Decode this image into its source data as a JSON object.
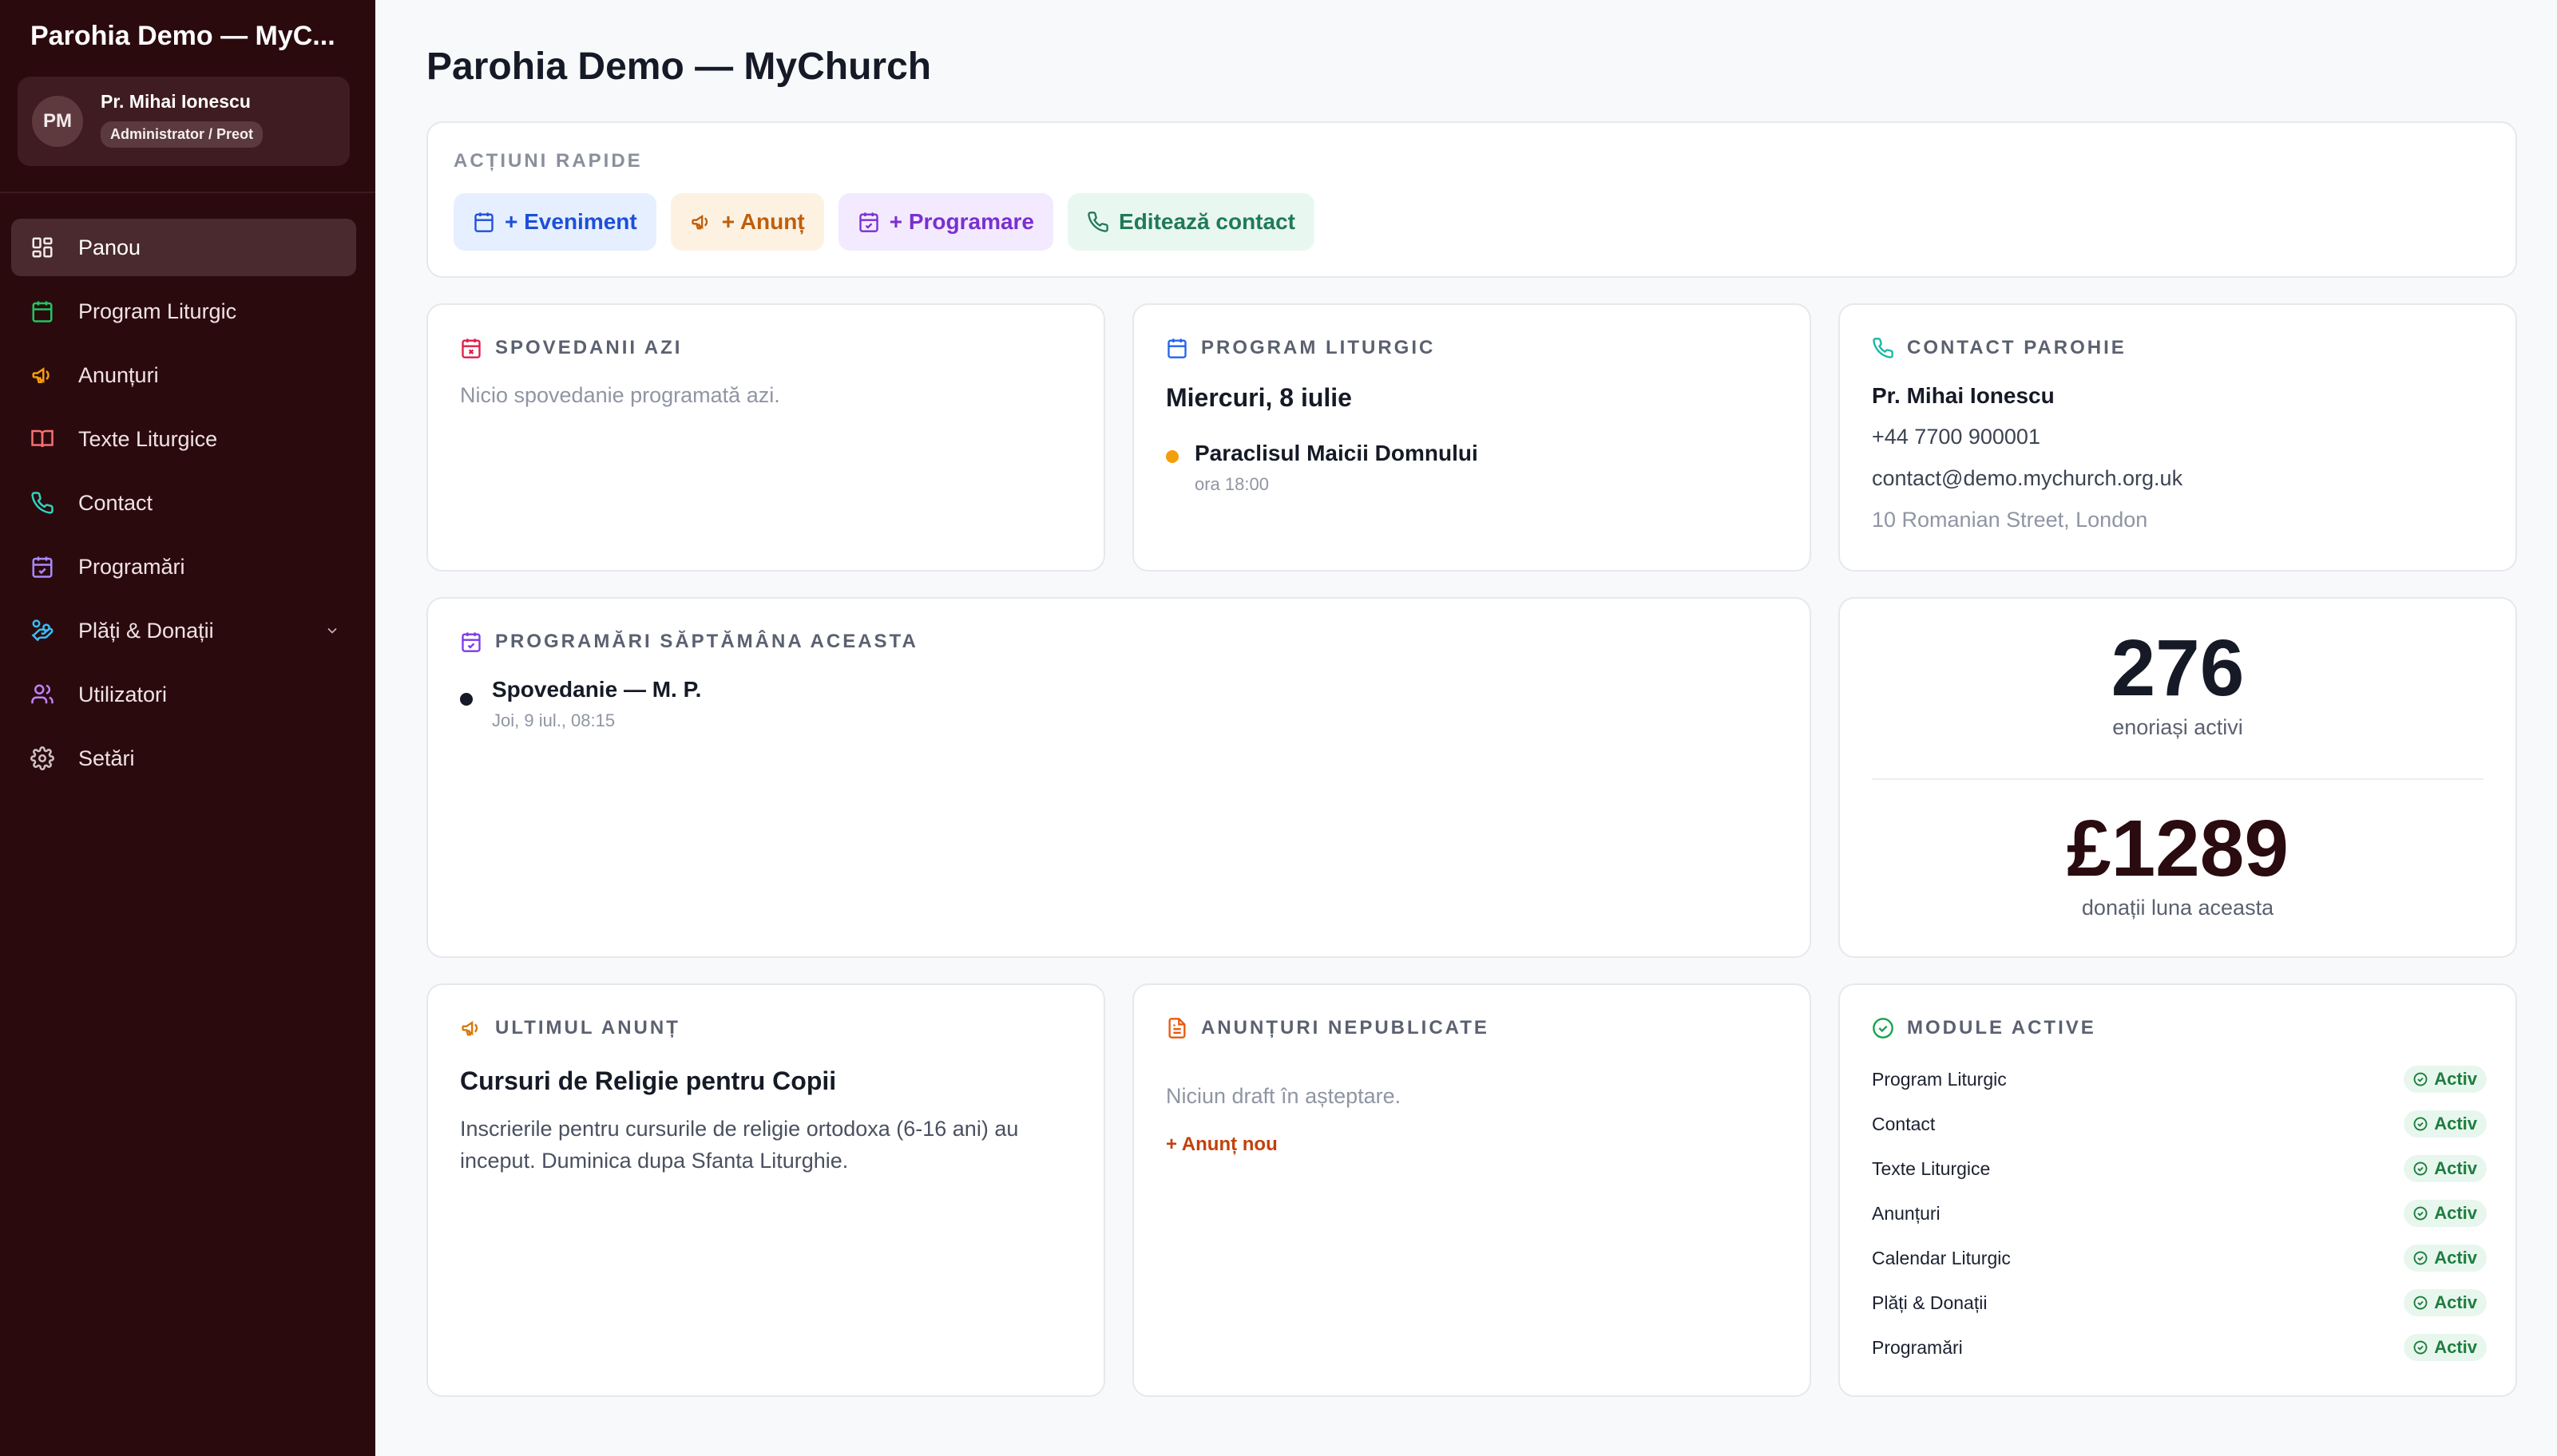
{
  "sidebar": {
    "app_title": "Parohia Demo — MyC...",
    "user": {
      "initials": "PM",
      "name": "Pr. Mihai Ionescu",
      "role": "Administrator / Preot"
    },
    "items": [
      {
        "label": "Panou",
        "icon": "dashboard-icon"
      },
      {
        "label": "Program Liturgic",
        "icon": "calendar-icon"
      },
      {
        "label": "Anunțuri",
        "icon": "megaphone-icon"
      },
      {
        "label": "Texte Liturgice",
        "icon": "book-icon"
      },
      {
        "label": "Contact",
        "icon": "phone-icon"
      },
      {
        "label": "Programări",
        "icon": "calendar-check-icon"
      },
      {
        "label": "Plăți & Donații",
        "icon": "hand-coins-icon"
      },
      {
        "label": "Utilizatori",
        "icon": "users-icon"
      },
      {
        "label": "Setări",
        "icon": "gear-icon"
      }
    ]
  },
  "main": {
    "title": "Parohia Demo — MyChurch",
    "quick_actions": {
      "label": "ACȚIUNI RAPIDE",
      "buttons": [
        "+ Eveniment",
        "+ Anunț",
        "+ Programare",
        "Editează contact"
      ]
    },
    "confessions": {
      "title": "SPOVEDANII AZI",
      "empty": "Nicio spovedanie programată azi."
    },
    "liturgical": {
      "title": "PROGRAM LITURGIC",
      "date": "Miercuri, 8 iulie",
      "event_name": "Paraclisul Maicii Domnului",
      "event_time": "ora 18:00"
    },
    "contact": {
      "title": "CONTACT PAROHIE",
      "name": "Pr. Mihai Ionescu",
      "phone": "+44 7700 900001",
      "email": "contact@demo.mychurch.org.uk",
      "address": "10 Romanian Street, London"
    },
    "appointments": {
      "title": "PROGRAMĂRI SĂPTĂMÂNA ACEASTA",
      "item_title": "Spovedanie — M. P.",
      "item_time": "Joi, 9 iul., 08:15"
    },
    "stats": {
      "parishioners": "276",
      "parishioners_label": "enoriași activi",
      "donations": "£1289",
      "donations_label": "donații luna aceasta"
    },
    "last_announcement": {
      "title": "ULTIMUL ANUNȚ",
      "heading": "Cursuri de Religie pentru Copii",
      "body": "Inscrierile pentru cursurile de religie ortodoxa (6-16 ani) au inceput. Duminica dupa Sfanta Liturghie."
    },
    "unpublished": {
      "title": "ANUNȚURI NEPUBLICATE",
      "empty": "Niciun draft în așteptare.",
      "action": "+ Anunț nou"
    },
    "modules": {
      "title": "MODULE ACTIVE",
      "status": "Activ",
      "items": [
        "Program Liturgic",
        "Contact",
        "Texte Liturgice",
        "Anunțuri",
        "Calendar Liturgic",
        "Plăți & Donații",
        "Programări"
      ]
    }
  },
  "colors": {
    "sidebar_bg": "#2b0a0e",
    "accent_blue": "#1d4fd8",
    "accent_orange": "#c05e0a",
    "accent_purple": "#7a2fd0",
    "accent_green": "#207a57",
    "event_dot": "#f59e0b",
    "stat_donations": "#2a0b10"
  }
}
